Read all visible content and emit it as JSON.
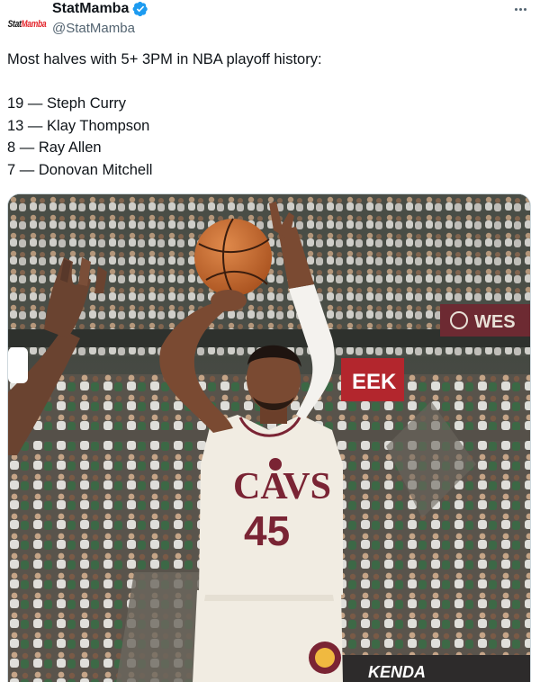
{
  "author": {
    "display_name": "StatMamba",
    "handle": "@StatMamba",
    "avatar_text": "Stat",
    "avatar_text_accent": "Mamba",
    "verified": true
  },
  "tweet": {
    "headline": "Most halves with 5+ 3PM in NBA playoff history:",
    "list": [
      "19 — Steph Curry",
      "13 — Klay Thompson",
      "8 — Ray Allen",
      "7 — Donovan Mitchell"
    ]
  },
  "media": {
    "jersey_team": "CAVS",
    "jersey_number": "45",
    "banner_text_1": "EEK",
    "banner_text_2": "WES",
    "floor_ad_text": "KENDA"
  },
  "colors": {
    "verified": "#1d9bf0",
    "handle": "#536471",
    "jersey_text": "#7a2434",
    "jersey": "#f1ece2",
    "ball": "#c9682f"
  },
  "icons": {
    "verified": "verified-badge-icon",
    "more": "more-horizontal-icon"
  }
}
